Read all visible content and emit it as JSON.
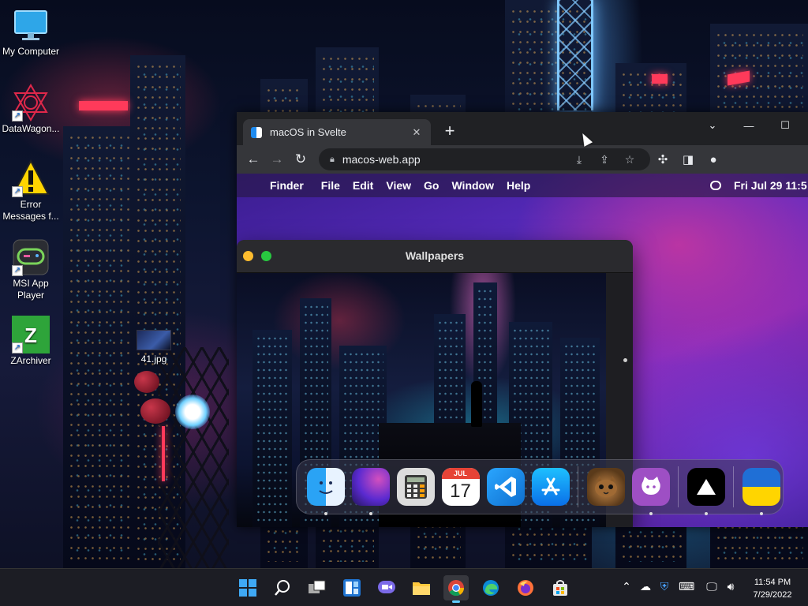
{
  "desktop": {
    "icons": [
      {
        "label": "My Computer",
        "icon": "monitor-icon"
      },
      {
        "label": "DataWagon...",
        "icon": "datawagon-icon",
        "shortcut": true
      },
      {
        "label": "Error Messages f...",
        "icon": "warning-icon",
        "shortcut": true
      },
      {
        "label": "MSI App Player",
        "icon": "gamepad-icon",
        "shortcut": true
      },
      {
        "label": "ZArchiver",
        "icon": "zarchiver-icon",
        "shortcut": true
      }
    ],
    "file": {
      "label": "41.jpg",
      "icon": "image-file-icon"
    }
  },
  "browser": {
    "tab_title": "macOS in Svelte",
    "tab_close": "✕",
    "new_tab": "+",
    "window_controls": {
      "collapse": "⌄",
      "minimize": "—",
      "maximize": "☐"
    },
    "nav": {
      "back": "←",
      "forward": "→",
      "reload": "↻"
    },
    "url": "macos-web.app",
    "toolbar_icons": [
      "install-icon",
      "share-icon",
      "star-icon",
      "extensions-icon",
      "side-panel-icon",
      "profile-icon"
    ]
  },
  "macos": {
    "menubar": {
      "apple": "",
      "items": [
        "Finder",
        "File",
        "Edit",
        "View",
        "Go",
        "Window",
        "Help"
      ],
      "clock": "Fri Jul 29  11:5"
    },
    "wallpapers_window": {
      "title": "Wallpapers"
    },
    "dock": {
      "apps": [
        {
          "name": "Finder",
          "running": true
        },
        {
          "name": "Wallpapers",
          "running": true
        },
        {
          "name": "Calculator",
          "running": false
        },
        {
          "name": "Calendar",
          "running": false,
          "month": "JUL",
          "day": "17"
        },
        {
          "name": "VS Code",
          "running": false
        },
        {
          "name": "App Store",
          "running": false
        },
        {
          "name": "Purus Twitter",
          "running": false
        },
        {
          "name": "GitHub",
          "running": true
        },
        {
          "name": "Vercel",
          "running": true
        },
        {
          "name": "Ukraine",
          "running": true
        }
      ]
    }
  },
  "taskbar": {
    "apps": [
      "start-icon",
      "search-icon",
      "task-view-icon",
      "widgets-icon",
      "chat-icon",
      "file-explorer-icon",
      "chrome-icon",
      "edge-icon",
      "firefox-icon",
      "store-icon"
    ],
    "active_app": "chrome-icon",
    "tray": [
      "chevron-up-icon",
      "onedrive-icon",
      "security-icon",
      "keyboard-icon",
      "network-icon",
      "volume-icon"
    ],
    "time": "11:54 PM",
    "date": "7/29/2022"
  },
  "colors": {
    "accent": "#60cdff",
    "chrome_bar": "#202124",
    "chrome_toolbar": "#35363a",
    "tl_yellow": "#febc2e",
    "tl_green": "#28c840"
  }
}
